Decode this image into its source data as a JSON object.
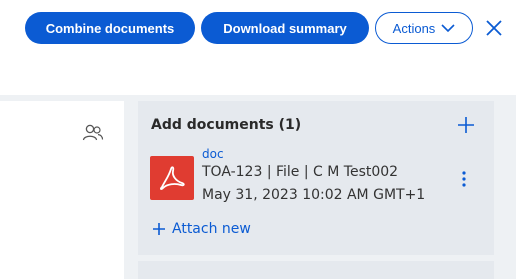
{
  "toolbar": {
    "combine_label": "Combine documents",
    "download_label": "Download summary",
    "actions_label": "Actions"
  },
  "icons": {
    "actions_chevron": "chevron-down-icon",
    "close": "close-icon",
    "people": "people-icon",
    "add": "plus-icon",
    "pdf": "pdf-icon",
    "more": "kebab-icon",
    "attach": "plus-icon"
  },
  "colors": {
    "accent": "#0b5bd3",
    "pdf_red": "#e03c31",
    "panel_bg": "#e5e9ee",
    "page_bg": "#eef1f4"
  },
  "add_documents": {
    "title": "Add documents (1)",
    "items": [
      {
        "type": "doc",
        "line1": "TOA-123 | File | C M Test002",
        "line2": "May 31, 2023 10:02 AM GMT+1"
      }
    ],
    "attach_label": "Attach new"
  }
}
